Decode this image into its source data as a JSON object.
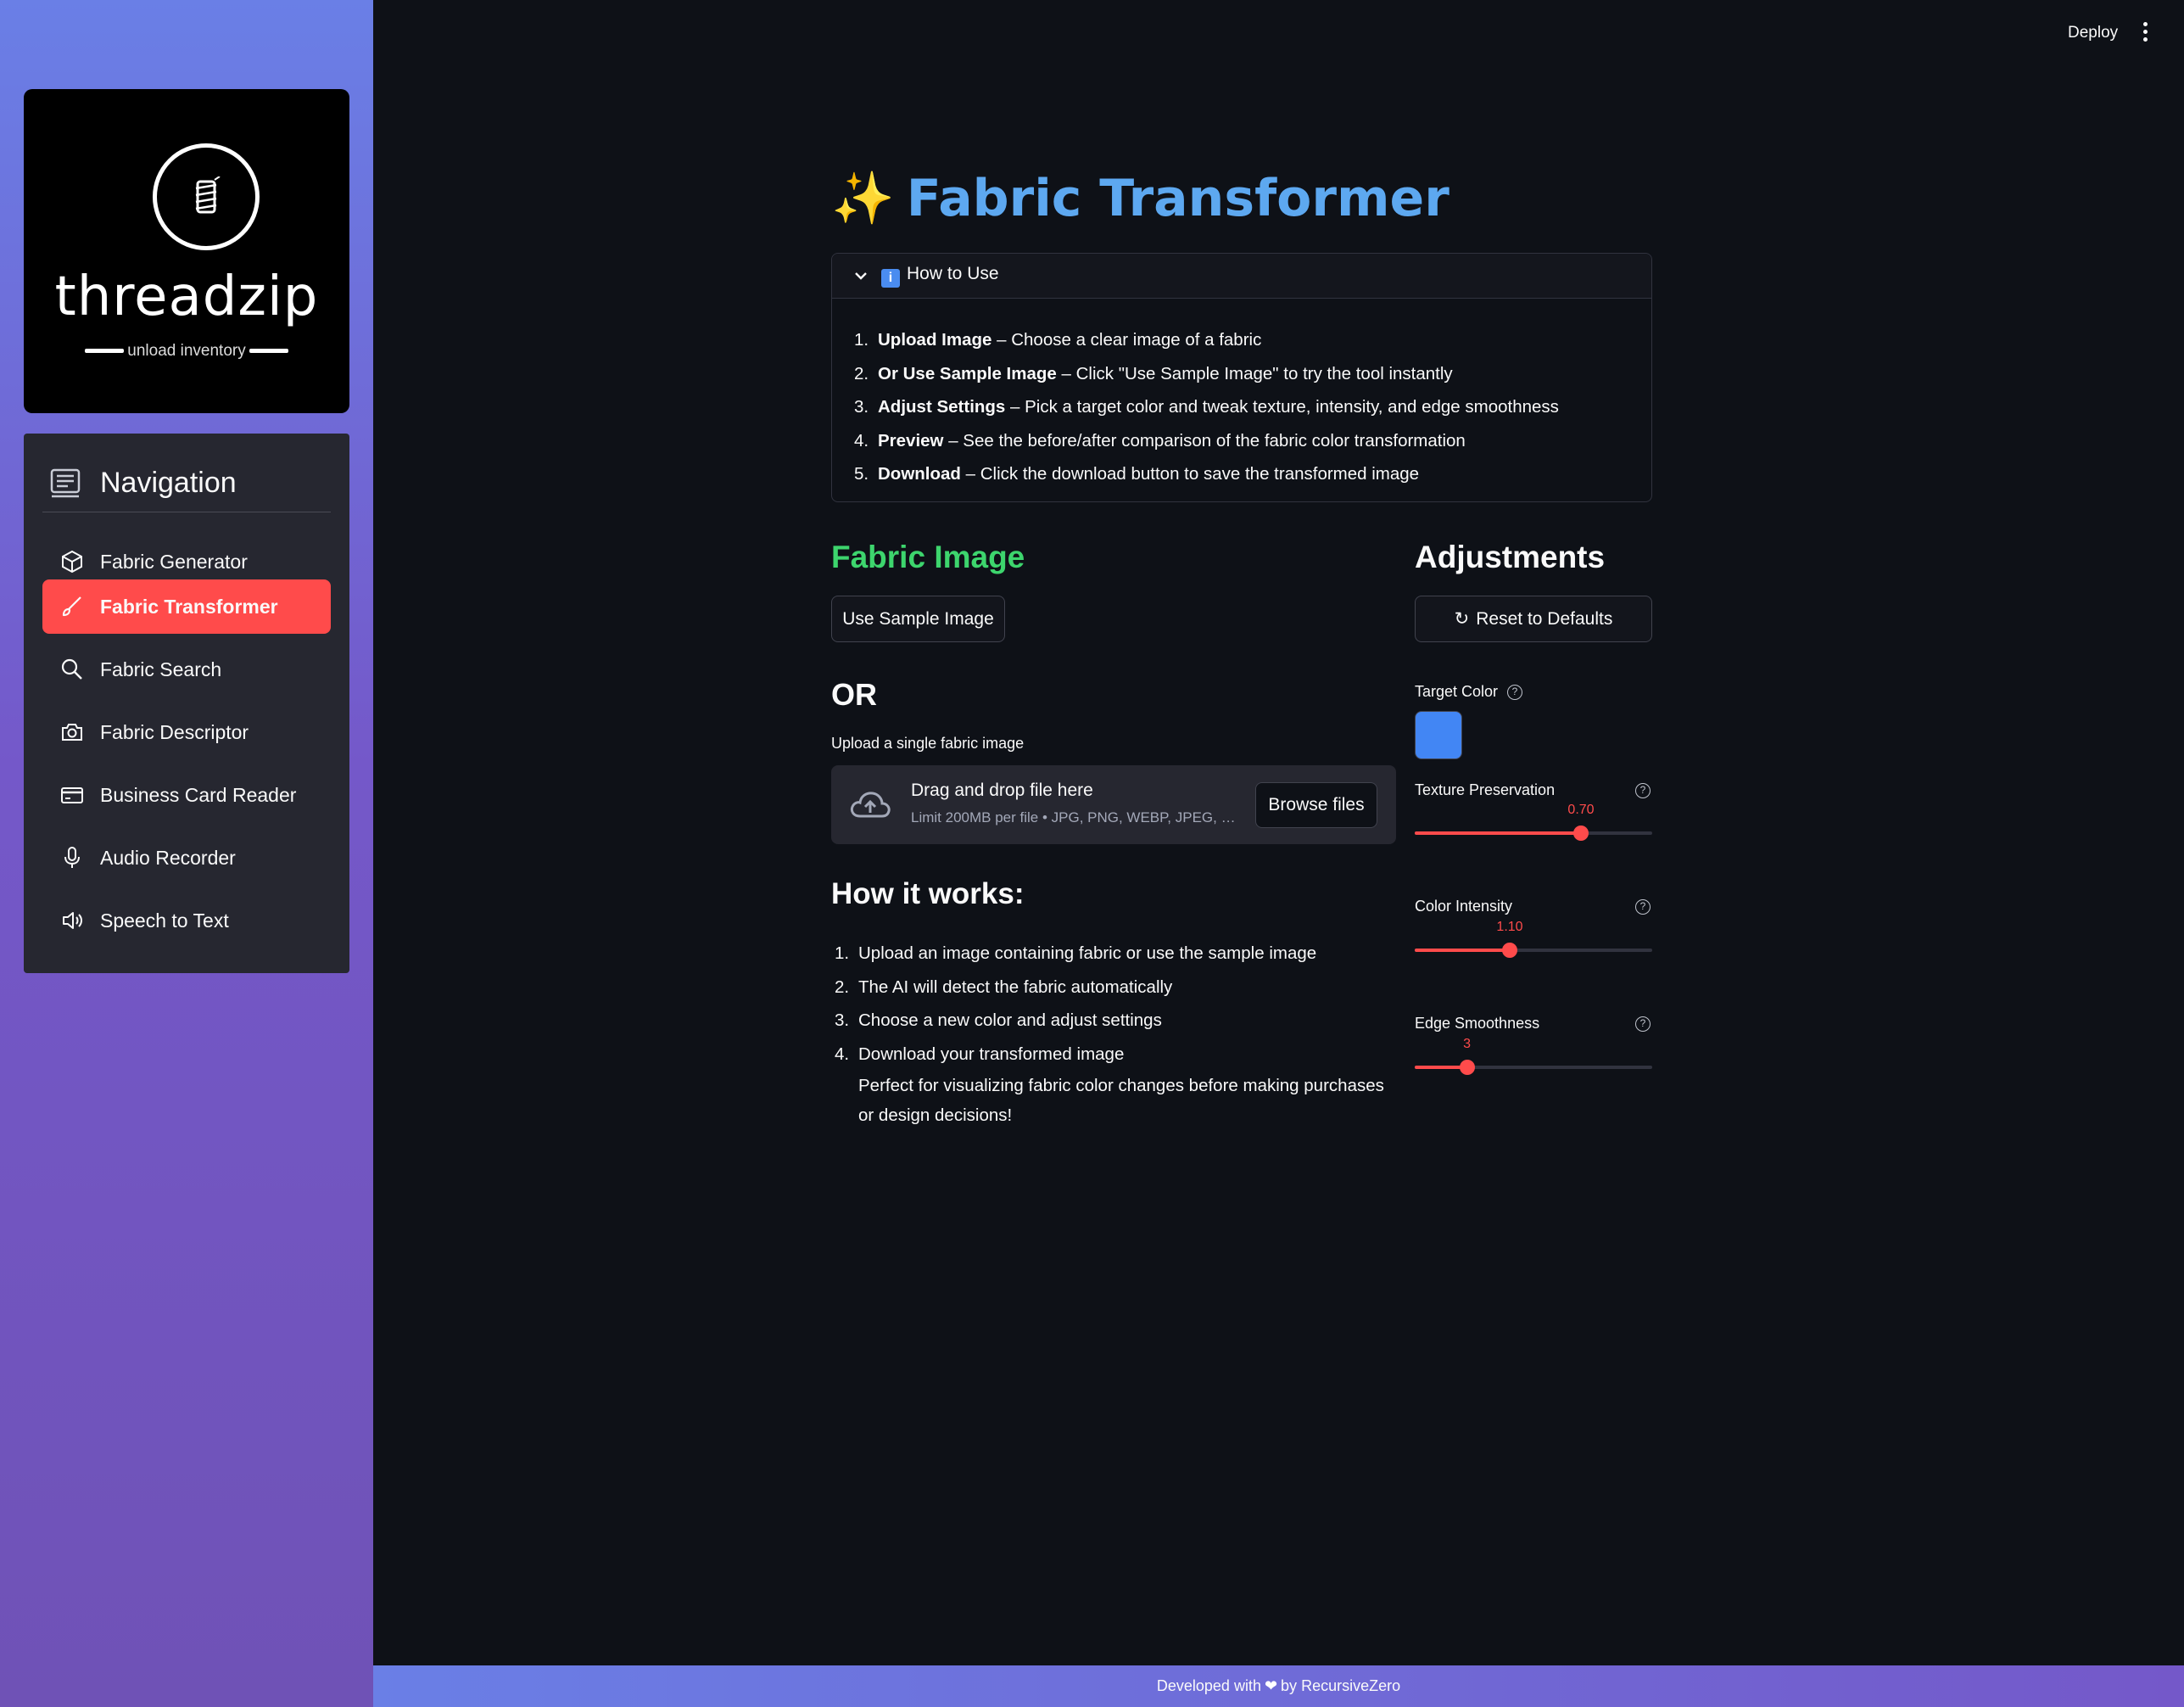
{
  "brand": {
    "name": "threadzip",
    "tagline": "unload inventory"
  },
  "sidebar": {
    "nav_title": "Navigation",
    "items": [
      {
        "label": "Fabric Generator",
        "icon": "cube-icon",
        "active": false
      },
      {
        "label": "Fabric Transformer",
        "icon": "brush-icon",
        "active": true
      },
      {
        "label": "Fabric Search",
        "icon": "search-icon",
        "active": false
      },
      {
        "label": "Fabric Descriptor",
        "icon": "camera-icon",
        "active": false
      },
      {
        "label": "Business Card Reader",
        "icon": "card-icon",
        "active": false
      },
      {
        "label": "Audio Recorder",
        "icon": "mic-icon",
        "active": false
      },
      {
        "label": "Speech to Text",
        "icon": "speaker-icon",
        "active": false
      }
    ]
  },
  "topbar": {
    "deploy_label": "Deploy"
  },
  "page": {
    "title_emoji": "✨",
    "title": "Fabric Transformer"
  },
  "how_to_use": {
    "label": "How to Use",
    "badge": "i",
    "steps": [
      {
        "num": "1.",
        "bold": "Upload Image",
        "text": " – Choose a clear image of a fabric"
      },
      {
        "num": "2.",
        "bold": "Or Use Sample Image",
        "text": " – Click \"Use Sample Image\" to try the tool instantly"
      },
      {
        "num": "3.",
        "bold": "Adjust Settings",
        "text": " – Pick a target color and tweak texture, intensity, and edge smoothness"
      },
      {
        "num": "4.",
        "bold": "Preview",
        "text": " – See the before/after comparison of the fabric color transformation"
      },
      {
        "num": "5.",
        "bold": "Download",
        "text": " – Click the download button to save the transformed image"
      }
    ]
  },
  "fabric_image": {
    "heading": "Fabric Image",
    "sample_button": "Use Sample Image",
    "or_label": "OR",
    "upload_label": "Upload a single fabric image",
    "dropzone_title": "Drag and drop file here",
    "dropzone_sub": "Limit 200MB per file • JPG, PNG, WEBP, JPEG, …",
    "browse_button": "Browse files"
  },
  "how_it_works": {
    "heading": "How it works:",
    "steps": [
      {
        "num": "1.",
        "text": "Upload an image containing fabric or use the sample image"
      },
      {
        "num": "2.",
        "text": "The AI will detect the fabric automatically"
      },
      {
        "num": "3.",
        "text": "Choose a new color and adjust settings"
      },
      {
        "num": "4.",
        "text": "Download your transformed image"
      }
    ],
    "note": "Perfect for visualizing fabric color changes before making purchases or design decisions!"
  },
  "adjustments": {
    "heading": "Adjustments",
    "reset_button": "Reset to Defaults",
    "target_color_label": "Target Color",
    "target_color": "#4286f4",
    "sliders": [
      {
        "label": "Texture Preservation",
        "value": "0.70",
        "fraction": 0.7
      },
      {
        "label": "Color Intensity",
        "value": "1.10",
        "fraction": 0.4
      },
      {
        "label": "Edge Smoothness",
        "value": "3",
        "fraction": 0.22
      }
    ]
  },
  "footer": {
    "prefix": "Developed with",
    "heart": "❤",
    "by": "by",
    "author": "RecursiveZero"
  },
  "colors": {
    "accent": "#ff4b4b",
    "title_blue": "#5da8f0",
    "heading_green": "#3dd56d",
    "background": "#0e1117"
  }
}
